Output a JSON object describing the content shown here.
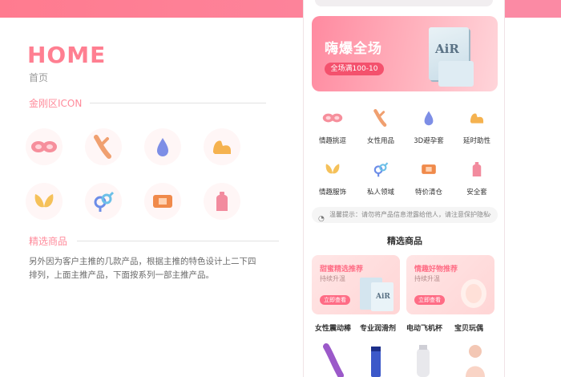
{
  "left": {
    "title": "HOME",
    "subtitle": "首页",
    "icon_section_label": "金刚区ICON",
    "featured_label": "精选商品",
    "description": "另外因为客户主推的几款产品，根据主推的特色设计上二下四排列，上面主推产品，下面按系列一部主推产品。",
    "icons": [
      "lips-icon",
      "rabbit-vibrator-icon",
      "drop-icon",
      "arm-icon",
      "butterfly-icon",
      "gender-icon",
      "bandage-icon",
      "cup-icon"
    ]
  },
  "phone": {
    "banner": {
      "title": "嗨爆全场",
      "button": "全场满100-10",
      "box_text": "AiR"
    },
    "categories": [
      {
        "label": "情趣挑逗",
        "icon": "lips-icon"
      },
      {
        "label": "女性用品",
        "icon": "rabbit-vibrator-icon"
      },
      {
        "label": "3D避孕套",
        "icon": "drop-icon"
      },
      {
        "label": "延时助性",
        "icon": "arm-icon"
      },
      {
        "label": "情趣服饰",
        "icon": "butterfly-icon"
      },
      {
        "label": "私人领域",
        "icon": "gender-icon"
      },
      {
        "label": "特价清仓",
        "icon": "bandage-icon"
      },
      {
        "label": "安全套",
        "icon": "cup-icon"
      }
    ],
    "notice": "温馨提示：请勿将产品信息泄露给他人，请注意保护隐私",
    "notice_arrow": "›",
    "featured_title": "精选商品",
    "cards": [
      {
        "title": "甜蜜精选推荐",
        "sub": "持续升温",
        "button": "立即查看"
      },
      {
        "title": "情趣好物推荐",
        "sub": "持续升温",
        "button": "立即查看"
      }
    ],
    "products": [
      "女性震动棒",
      "专业润滑剂",
      "电动飞机杯",
      "宝贝玩偶"
    ]
  },
  "colors": {
    "brand": "#ff7f91",
    "accent": "#f4516d"
  }
}
